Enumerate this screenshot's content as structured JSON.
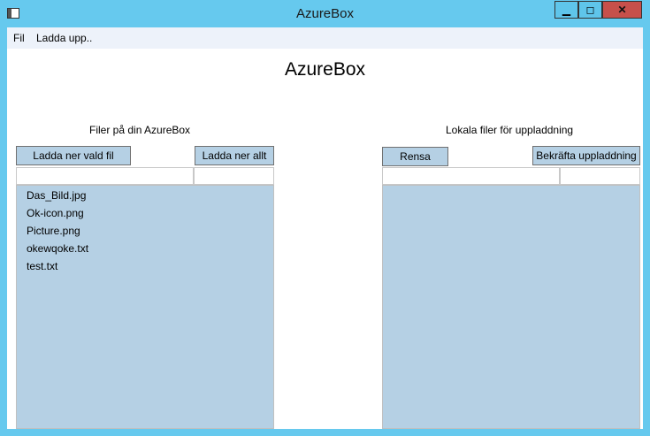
{
  "window": {
    "title": "AzureBox",
    "min_glyph": "▁",
    "max_glyph": "◻",
    "close_glyph": "✕"
  },
  "menu": {
    "items": [
      "Fil",
      "Ladda upp.."
    ]
  },
  "main": {
    "heading": "AzureBox"
  },
  "left": {
    "section_label": "Filer på din AzureBox",
    "download_selected_label": "Ladda ner vald fil",
    "download_all_label": "Ladda ner allt",
    "files": [
      "Das_Bild.jpg",
      "Ok-icon.png",
      "Picture.png",
      "okewqoke.txt",
      "test.txt"
    ]
  },
  "right": {
    "section_label": "Lokala filer för uppladdning",
    "clear_label": "Rensa",
    "confirm_upload_label": "Bekräfta uppladdning"
  },
  "colors": {
    "titlebar": "#66c9ee",
    "close": "#c7504b",
    "panel": "#b5d0e4",
    "menubar": "#edf2fa"
  }
}
